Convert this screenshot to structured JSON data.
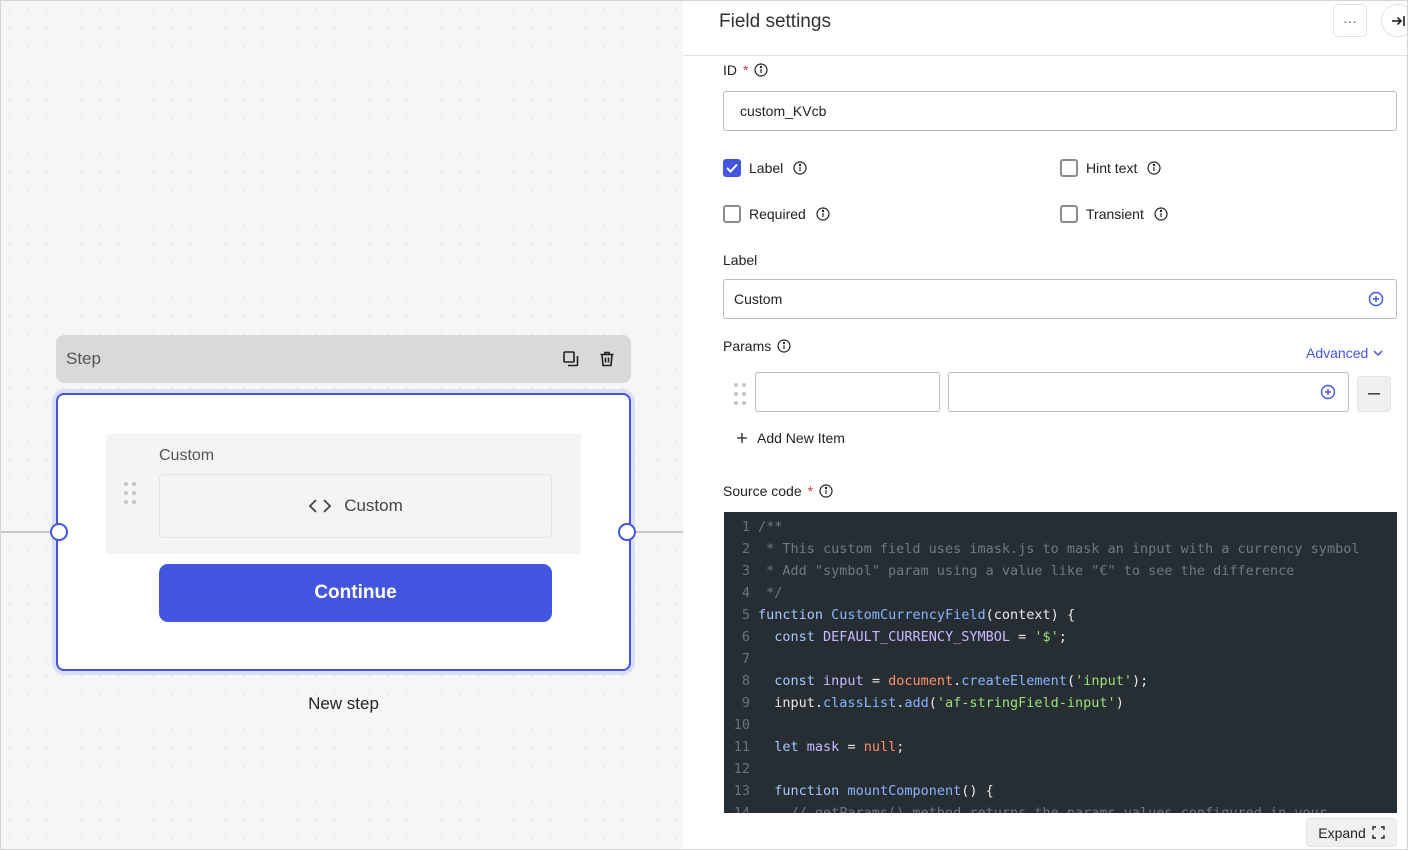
{
  "canvas": {
    "step": {
      "title": "Step",
      "name": "New step",
      "field": {
        "label": "Custom",
        "widget_label": "Custom"
      },
      "continue_label": "Continue"
    }
  },
  "panel": {
    "title": "Field settings",
    "more_label": "···",
    "id_field": {
      "label": "ID",
      "required_mark": "*",
      "value": "custom_KVcb"
    },
    "options": [
      {
        "label": "Label",
        "checked": true
      },
      {
        "label": "Hint text",
        "checked": false
      },
      {
        "label": "Required",
        "checked": false
      },
      {
        "label": "Transient",
        "checked": false
      }
    ],
    "label_field": {
      "label": "Label",
      "value": "Custom"
    },
    "params": {
      "label": "Params",
      "advanced_label": "Advanced",
      "key_value": "",
      "value_value": "",
      "add_item_label": "Add New Item"
    },
    "source_code": {
      "label": "Source code",
      "required_mark": "*",
      "expand_label": "Expand",
      "lines": [
        "/**",
        " * This custom field uses imask.js to mask an input with a currency symbol",
        " * Add \"symbol\" param using a value like \"€\" to see the difference",
        " */",
        "function CustomCurrencyField(context) {",
        "  const DEFAULT_CURRENCY_SYMBOL = '$';",
        "",
        "  const input = document.createElement('input');",
        "  input.classList.add('af-stringField-input')",
        "",
        "  let mask = null;",
        "",
        "  function mountComponent() {",
        "    // getParams() method returns the params values configured in your"
      ]
    }
  },
  "colors": {
    "accent": "#4355df",
    "code_background": "#272e33"
  }
}
